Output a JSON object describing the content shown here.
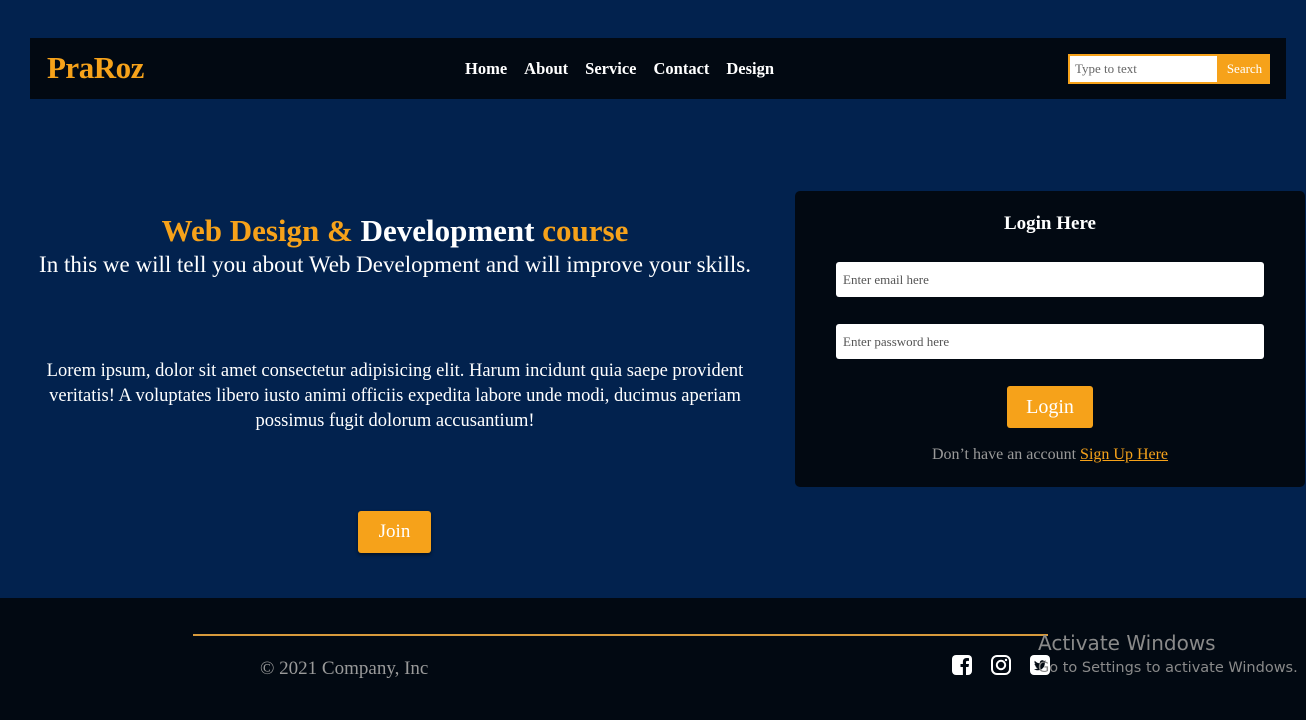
{
  "navbar": {
    "logo": "PraRoz",
    "links": [
      "Home",
      "About",
      "Service",
      "Contact",
      "Design"
    ],
    "search": {
      "placeholder": "Type to text",
      "button_label": "Search"
    }
  },
  "hero": {
    "title_part1": "Web Design &",
    "title_part2": "Development",
    "title_part3": "course",
    "subtitle": "In this we will tell you about Web Development and will improve your skills.",
    "body": "Lorem ipsum, dolor sit amet consectetur adipisicing elit. Harum incidunt quia saepe provident veritatis! A voluptates libero iusto animi officiis expedita labore unde modi, ducimus aperiam possimus fugit dolorum accusantium!",
    "join_label": "Join"
  },
  "login": {
    "title": "Login Here",
    "email_placeholder": "Enter email here",
    "password_placeholder": "Enter password here",
    "button_label": "Login",
    "signup_prompt": "Don’t have an account",
    "signup_link": "Sign Up Here"
  },
  "footer": {
    "copyright": "© 2021 Company, Inc",
    "social_icons": [
      "facebook-icon",
      "instagram-icon",
      "twitter-icon"
    ]
  },
  "watermark": {
    "title": "Activate Windows",
    "subtitle": "Go to Settings to activate Windows."
  },
  "colors": {
    "background": "#02224e",
    "navbar": "#020912",
    "accent": "#f6a21a",
    "muted_text": "#9a9a9a"
  }
}
